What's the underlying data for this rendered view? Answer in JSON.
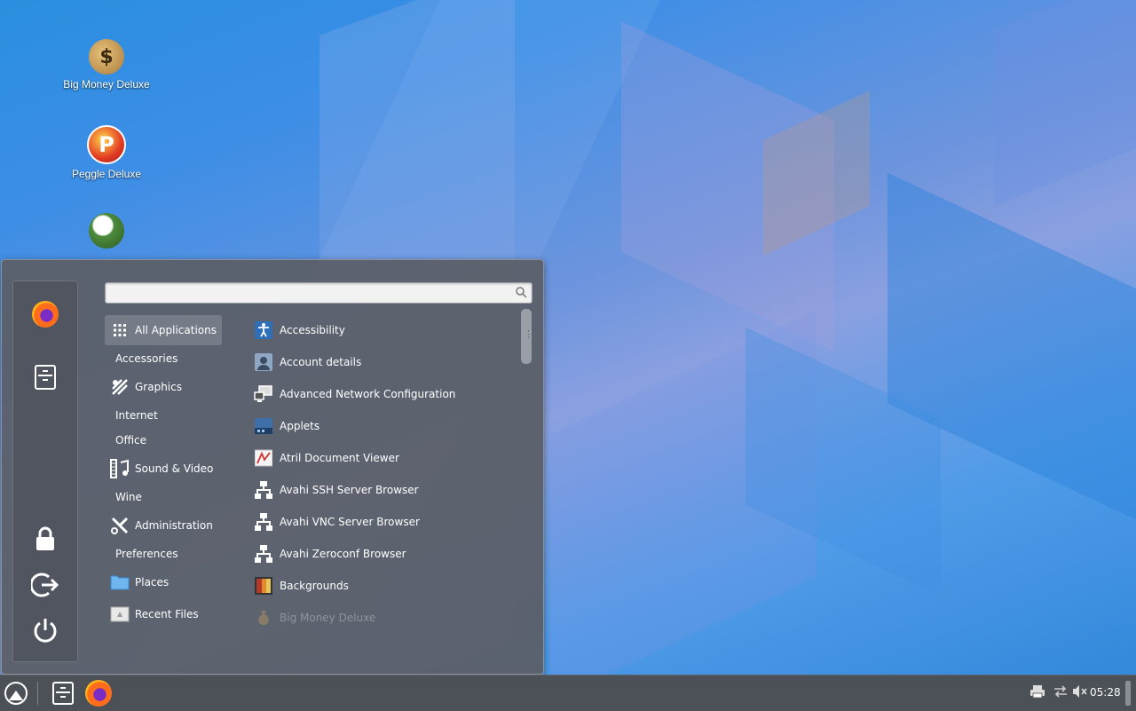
{
  "desktop": {
    "icons": [
      {
        "label": "Big Money Deluxe",
        "icon": "money-bag-icon"
      },
      {
        "label": "Peggle Deluxe",
        "icon": "peggle-icon"
      },
      {
        "label": "",
        "icon": "flower-game-icon"
      }
    ]
  },
  "menu": {
    "search": {
      "value": "",
      "placeholder": ""
    },
    "favorites": [
      {
        "name": "Firefox",
        "icon": "firefox-icon"
      },
      {
        "name": "Files",
        "icon": "file-cabinet-icon"
      }
    ],
    "system": [
      {
        "name": "Lock screen",
        "icon": "lock-icon"
      },
      {
        "name": "Log out",
        "icon": "logout-icon"
      },
      {
        "name": "Shut down",
        "icon": "power-icon"
      }
    ],
    "categories": [
      {
        "label": "All Applications",
        "icon": "grid-icon",
        "selected": true
      },
      {
        "label": "Accessories",
        "icon": ""
      },
      {
        "label": "Graphics",
        "icon": "graphics-icon"
      },
      {
        "label": "Internet",
        "icon": ""
      },
      {
        "label": "Office",
        "icon": ""
      },
      {
        "label": "Sound & Video",
        "icon": "sound-video-icon"
      },
      {
        "label": "Wine",
        "icon": ""
      },
      {
        "label": "Administration",
        "icon": "tools-icon"
      },
      {
        "label": "Preferences",
        "icon": ""
      },
      {
        "label": "Places",
        "icon": "folder-icon"
      },
      {
        "label": "Recent Files",
        "icon": "recent-files-icon"
      }
    ],
    "apps": [
      {
        "label": "Accessibility",
        "icon": "accessibility-icon"
      },
      {
        "label": "Account details",
        "icon": "account-icon"
      },
      {
        "label": "Advanced Network Configuration",
        "icon": "network-config-icon"
      },
      {
        "label": "Applets",
        "icon": "applets-icon"
      },
      {
        "label": "Atril Document Viewer",
        "icon": "document-viewer-icon"
      },
      {
        "label": "Avahi SSH Server Browser",
        "icon": "avahi-network-icon"
      },
      {
        "label": "Avahi VNC Server Browser",
        "icon": "avahi-network-icon"
      },
      {
        "label": "Avahi Zeroconf Browser",
        "icon": "avahi-network-icon"
      },
      {
        "label": "Backgrounds",
        "icon": "backgrounds-icon"
      },
      {
        "label": "Big Money Deluxe",
        "icon": "money-bag-icon",
        "dim": true
      }
    ]
  },
  "taskbar": {
    "clock": "05:28",
    "tray": [
      {
        "name": "printer",
        "icon": "printer-icon"
      },
      {
        "name": "network",
        "icon": "network-arrows-icon"
      },
      {
        "name": "volume",
        "icon": "volume-muted-icon"
      }
    ]
  },
  "colors": {
    "menu_bg": "#5c606a",
    "taskbar_bg": "#4c5057",
    "selected_bg": "#787e8a"
  }
}
